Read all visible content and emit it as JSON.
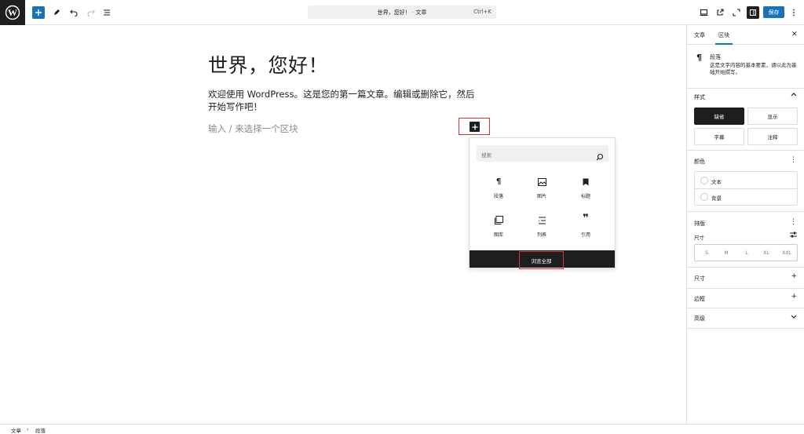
{
  "topbar": {
    "command_title": "世界，您好！",
    "command_sep": "· ",
    "command_type": "文章",
    "command_shortcut": "Ctrl+K",
    "save_label": "保存"
  },
  "editor": {
    "post_title": "世界，您好！",
    "paragraph": "欢迎使用 WordPress。这是您的第一篇文章。编辑或删除它，然后开始写作吧！",
    "placeholder": "输入 / 来选择一个区块"
  },
  "inserter": {
    "search_placeholder": "搜索",
    "blocks": [
      {
        "label": "段落",
        "icon": "paragraph-icon"
      },
      {
        "label": "图片",
        "icon": "image-icon"
      },
      {
        "label": "标题",
        "icon": "heading-icon"
      },
      {
        "label": "图库",
        "icon": "gallery-icon"
      },
      {
        "label": "列表",
        "icon": "list-icon"
      },
      {
        "label": "引用",
        "icon": "quote-icon"
      }
    ],
    "browse_all": "浏览全部"
  },
  "sidebar": {
    "tabs": [
      "文章",
      "区块"
    ],
    "active_tab": "区块",
    "block_name": "段落",
    "block_desc": "这是文字内容的基本要素，请以此为基础开始撰写。",
    "styles_title": "样式",
    "styles": [
      "缺省",
      "显示",
      "字幕",
      "注释"
    ],
    "color_title": "颜色",
    "colors": [
      "文本",
      "背景"
    ],
    "typography_title": "排版",
    "size_label": "尺寸",
    "sizes": [
      "S",
      "M",
      "L",
      "XL",
      "XXL"
    ],
    "dimensions_title": "尺寸",
    "border_title": "边框",
    "advanced_title": "高级"
  },
  "footer": {
    "crumbs": [
      "文章",
      "段落"
    ],
    "crumb_sep": "›"
  },
  "colors": {
    "accent": "#1a73b8",
    "highlight": "#d63638",
    "dark": "#1e1e1e"
  }
}
